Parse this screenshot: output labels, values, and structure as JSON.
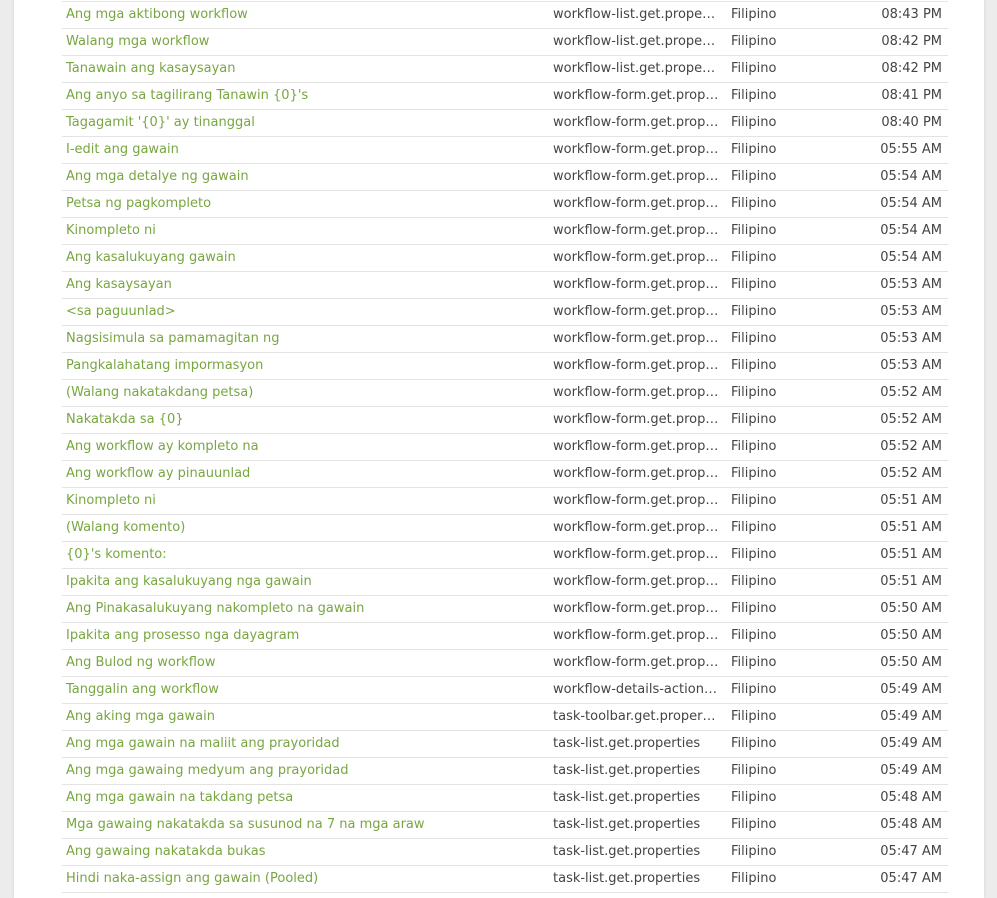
{
  "colors": {
    "link": "#78a641",
    "text": "#444444",
    "divider": "#e3e3e3"
  },
  "rows": [
    {
      "label": "Ang mga aktibong workflow",
      "file": "workflow-list.get.properties",
      "language": "Filipino",
      "time": "08:43 PM"
    },
    {
      "label": "Walang mga workflow",
      "file": "workflow-list.get.properties",
      "language": "Filipino",
      "time": "08:42 PM"
    },
    {
      "label": "Tanawain ang kasaysayan",
      "file": "workflow-list.get.properties",
      "language": "Filipino",
      "time": "08:42 PM"
    },
    {
      "label": "Ang anyo sa tagilirang Tanawin {0}'s",
      "file": "workflow-form.get.properties",
      "language": "Filipino",
      "time": "08:41 PM"
    },
    {
      "label": "Tagagamit '{0}' ay tinanggal",
      "file": "workflow-form.get.properties",
      "language": "Filipino",
      "time": "08:40 PM"
    },
    {
      "label": "I-edit ang gawain",
      "file": "workflow-form.get.properties",
      "language": "Filipino",
      "time": "05:55 AM"
    },
    {
      "label": "Ang mga detalye ng gawain",
      "file": "workflow-form.get.properties",
      "language": "Filipino",
      "time": "05:54 AM"
    },
    {
      "label": "Petsa ng pagkompleto",
      "file": "workflow-form.get.properties",
      "language": "Filipino",
      "time": "05:54 AM"
    },
    {
      "label": "Kinompleto ni",
      "file": "workflow-form.get.properties",
      "language": "Filipino",
      "time": "05:54 AM"
    },
    {
      "label": "Ang kasalukuyang gawain",
      "file": "workflow-form.get.properties",
      "language": "Filipino",
      "time": "05:54 AM"
    },
    {
      "label": "Ang kasaysayan",
      "file": "workflow-form.get.properties",
      "language": "Filipino",
      "time": "05:53 AM"
    },
    {
      "label": "<sa paguunlad>",
      "file": "workflow-form.get.properties",
      "language": "Filipino",
      "time": "05:53 AM"
    },
    {
      "label": "Nagsisimula sa pamamagitan ng",
      "file": "workflow-form.get.properties",
      "language": "Filipino",
      "time": "05:53 AM"
    },
    {
      "label": "Pangkalahatang impormasyon",
      "file": "workflow-form.get.properties",
      "language": "Filipino",
      "time": "05:53 AM"
    },
    {
      "label": "(Walang nakatakdang petsa)",
      "file": "workflow-form.get.properties",
      "language": "Filipino",
      "time": "05:52 AM"
    },
    {
      "label": "Nakatakda sa {0}",
      "file": "workflow-form.get.properties",
      "language": "Filipino",
      "time": "05:52 AM"
    },
    {
      "label": "Ang workflow ay kompleto na",
      "file": "workflow-form.get.properties",
      "language": "Filipino",
      "time": "05:52 AM"
    },
    {
      "label": "Ang workflow ay pinauunlad",
      "file": "workflow-form.get.properties",
      "language": "Filipino",
      "time": "05:52 AM"
    },
    {
      "label": "Kinompleto ni",
      "file": "workflow-form.get.properties",
      "language": "Filipino",
      "time": "05:51 AM"
    },
    {
      "label": "(Walang komento)",
      "file": "workflow-form.get.properties",
      "language": "Filipino",
      "time": "05:51 AM"
    },
    {
      "label": "{0}'s komento:",
      "file": "workflow-form.get.properties",
      "language": "Filipino",
      "time": "05:51 AM"
    },
    {
      "label": "Ipakita ang kasalukuyang nga gawain",
      "file": "workflow-form.get.properties",
      "language": "Filipino",
      "time": "05:51 AM"
    },
    {
      "label": "Ang Pinakasalukuyang nakompleto na gawain",
      "file": "workflow-form.get.properties",
      "language": "Filipino",
      "time": "05:50 AM"
    },
    {
      "label": "Ipakita ang prosesso nga dayagram",
      "file": "workflow-form.get.properties",
      "language": "Filipino",
      "time": "05:50 AM"
    },
    {
      "label": "Ang Bulod ng workflow",
      "file": "workflow-form.get.properties",
      "language": "Filipino",
      "time": "05:50 AM"
    },
    {
      "label": "Tanggalin ang workflow",
      "file": "workflow-details-actions.get.properties",
      "language": "Filipino",
      "time": "05:49 AM"
    },
    {
      "label": "Ang aking mga gawain",
      "file": "task-toolbar.get.properties",
      "language": "Filipino",
      "time": "05:49 AM"
    },
    {
      "label": "Ang mga gawain na maliit ang prayoridad",
      "file": "task-list.get.properties",
      "language": "Filipino",
      "time": "05:49 AM"
    },
    {
      "label": "Ang mga gawaing medyum ang prayoridad",
      "file": "task-list.get.properties",
      "language": "Filipino",
      "time": "05:49 AM"
    },
    {
      "label": "Ang mga gawain na takdang petsa",
      "file": "task-list.get.properties",
      "language": "Filipino",
      "time": "05:48 AM"
    },
    {
      "label": "Mga gawaing nakatakda sa susunod na 7 na mga araw",
      "file": "task-list.get.properties",
      "language": "Filipino",
      "time": "05:48 AM"
    },
    {
      "label": "Ang gawaing nakatakda bukas",
      "file": "task-list.get.properties",
      "language": "Filipino",
      "time": "05:47 AM"
    },
    {
      "label": "Hindi naka-assign ang gawain (Pooled)",
      "file": "task-list.get.properties",
      "language": "Filipino",
      "time": "05:47 AM"
    }
  ]
}
